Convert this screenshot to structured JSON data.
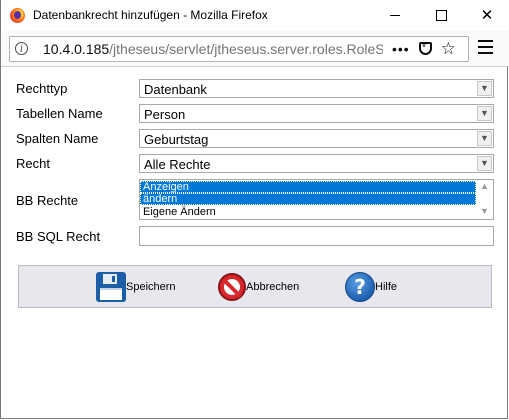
{
  "window": {
    "title": "Datenbankrecht hinzufügen - Mozilla Firefox",
    "minimize_icon": "minimize-icon",
    "maximize_icon": "maximize-icon",
    "close_icon": "close-icon"
  },
  "urlbar": {
    "host": "10.4.0.185",
    "path": "/jtheseus/servlet/jtheseus.server.roles.RoleSe",
    "more": "•••"
  },
  "form": {
    "rechttyp": {
      "label": "Rechttyp",
      "value": "Datenbank"
    },
    "tabellen": {
      "label": "Tabellen Name",
      "value": "Person"
    },
    "spalten": {
      "label": "Spalten Name",
      "value": "Geburtstag"
    },
    "recht": {
      "label": "Recht",
      "value": "Alle Rechte"
    },
    "bb_rechte": {
      "label": "BB Rechte",
      "options": [
        {
          "text": "Anzeigen",
          "selected": true
        },
        {
          "text": "ändern",
          "selected": true
        },
        {
          "text": "Eigene Ändern",
          "selected": false
        }
      ]
    },
    "bb_sql": {
      "label": "BB SQL Recht",
      "value": ""
    }
  },
  "toolbar": {
    "save_label": "Speichern",
    "cancel_label": "Abbrechen",
    "help_label": "Hilfe"
  },
  "colors": {
    "selection": "#0078d7",
    "toolbar_bg": "#e6e8ee",
    "save_icon": "#1d5ea8",
    "cancel_icon": "#d8262b",
    "help_icon": "#1f5fb0"
  }
}
